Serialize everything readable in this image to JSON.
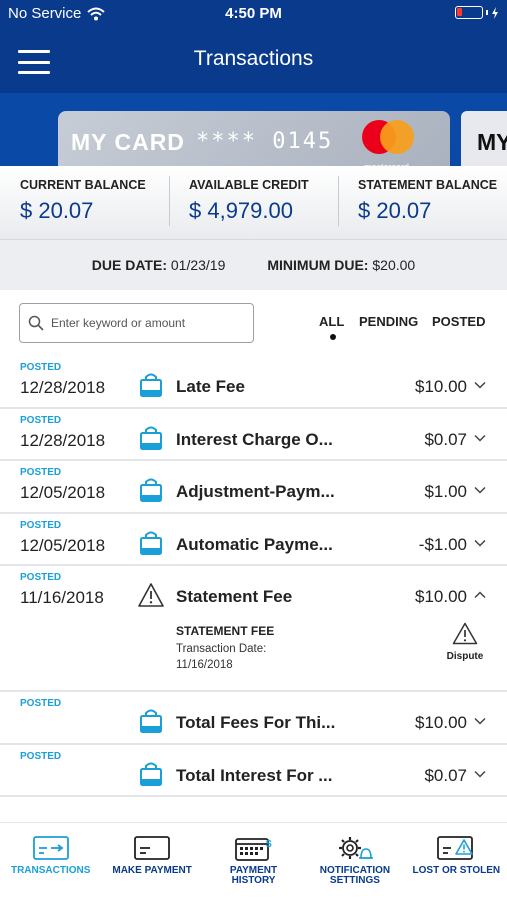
{
  "status_bar": {
    "carrier": "No Service",
    "time": "4:50 PM"
  },
  "header": {
    "title": "Transactions"
  },
  "cards": [
    {
      "name": "MY CARD",
      "number": "**** 0145",
      "network": "mastercard"
    },
    {
      "name": "MY"
    }
  ],
  "balances": [
    {
      "label": "CURRENT BALANCE",
      "value": "$ 20.07"
    },
    {
      "label": "AVAILABLE CREDIT",
      "value": "$ 4,979.00"
    },
    {
      "label": "STATEMENT BALANCE",
      "value": "$ 20.07"
    }
  ],
  "due": {
    "due_date_label": "DUE DATE:",
    "due_date": "01/23/19",
    "minimum_due_label": "MINIMUM DUE:",
    "minimum_due": "$20.00"
  },
  "search": {
    "placeholder": "Enter keyword or amount"
  },
  "filters": {
    "all": "ALL",
    "pending": "PENDING",
    "posted": "POSTED",
    "selected": "ALL"
  },
  "transactions": [
    {
      "status": "POSTED",
      "date": "12/28/2018",
      "description": "Late Fee",
      "amount": "$10.00",
      "icon": "shopping-bag-icon"
    },
    {
      "status": "POSTED",
      "date": "12/28/2018",
      "description": "Interest Charge O...",
      "amount": "$0.07",
      "icon": "shopping-bag-icon"
    },
    {
      "status": "POSTED",
      "date": "12/05/2018",
      "description": "Adjustment-Paym...",
      "amount": "$1.00",
      "icon": "shopping-bag-icon"
    },
    {
      "status": "POSTED",
      "date": "12/05/2018",
      "description": "Automatic Payme...",
      "amount": "-$1.00",
      "icon": "shopping-bag-icon"
    },
    {
      "status": "POSTED",
      "date": "11/16/2018",
      "description": "Statement Fee",
      "amount": "$10.00",
      "icon": "warning-icon",
      "detail": {
        "title": "STATEMENT FEE",
        "line1": "Transaction Date:",
        "line2": "11/16/2018",
        "action": "Dispute"
      }
    },
    {
      "status": "POSTED",
      "date": "",
      "description": "Total Fees For Thi...",
      "amount": "$10.00",
      "icon": "shopping-bag-icon"
    },
    {
      "status": "POSTED",
      "date": "",
      "description": "Total Interest For ...",
      "amount": "$0.07",
      "icon": "shopping-bag-icon"
    }
  ],
  "bottom_nav": [
    {
      "label_line1": "TRANSACTIONS",
      "label_line2": "",
      "active": true
    },
    {
      "label_line1": "MAKE PAYMENT",
      "label_line2": ""
    },
    {
      "label_line1": "PAYMENT",
      "label_line2": "HISTORY"
    },
    {
      "label_line1": "NOTIFICATION",
      "label_line2": "SETTINGS"
    },
    {
      "label_line1": "LOST OR STOLEN",
      "label_line2": ""
    }
  ],
  "colors": {
    "header": "#0a3a8c",
    "accent": "#1a9fd8",
    "card_strip": "#0a4aa6"
  }
}
